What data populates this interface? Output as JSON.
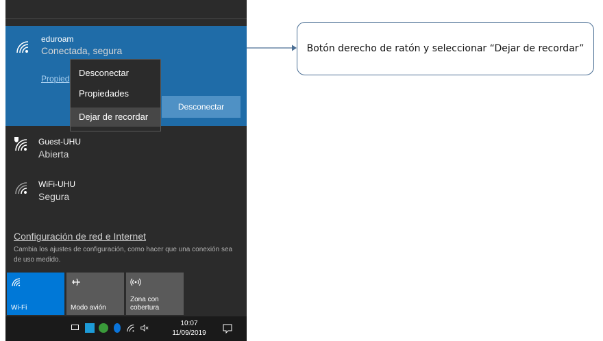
{
  "networks": [
    {
      "name": "eduroam",
      "status": "Conectada, segura",
      "secured": true
    },
    {
      "name": "Guest-UHU",
      "status": "Abierta",
      "secured": false
    },
    {
      "name": "WiFi-UHU",
      "status": "Segura",
      "secured": true
    }
  ],
  "active_network": {
    "properties_link": "Propied",
    "disconnect_button": "Desconectar"
  },
  "context_menu": {
    "items": [
      {
        "label": "Desconectar",
        "selected": false
      },
      {
        "label": "Propiedades",
        "selected": false
      },
      {
        "label": "Dejar de recordar",
        "selected": true
      }
    ]
  },
  "settings": {
    "link": "Configuración de red e Internet",
    "description": "Cambia los ajustes de configuración, como hacer que una conexión sea de uso medido."
  },
  "tiles": [
    {
      "label": "Wi-Fi",
      "icon": "wifi-icon",
      "active": true,
      "color": "#0078d7"
    },
    {
      "label": "Modo avión",
      "icon": "airplane-icon",
      "active": false,
      "color": "#5a5a5a"
    },
    {
      "label": "Zona con cobertura",
      "icon": "hotspot-icon",
      "active": false,
      "color": "#5a5a5a"
    }
  ],
  "taskbar": {
    "time": "10:07",
    "date": "11/09/2019"
  },
  "callout": {
    "text": "Botón derecho de ratón y seleccionar “Dejar de recordar”"
  },
  "colors": {
    "accent": "#1f6ca8",
    "panel": "#2b2b2b",
    "button": "#4f91c5",
    "callout_border": "#4a6e94"
  }
}
